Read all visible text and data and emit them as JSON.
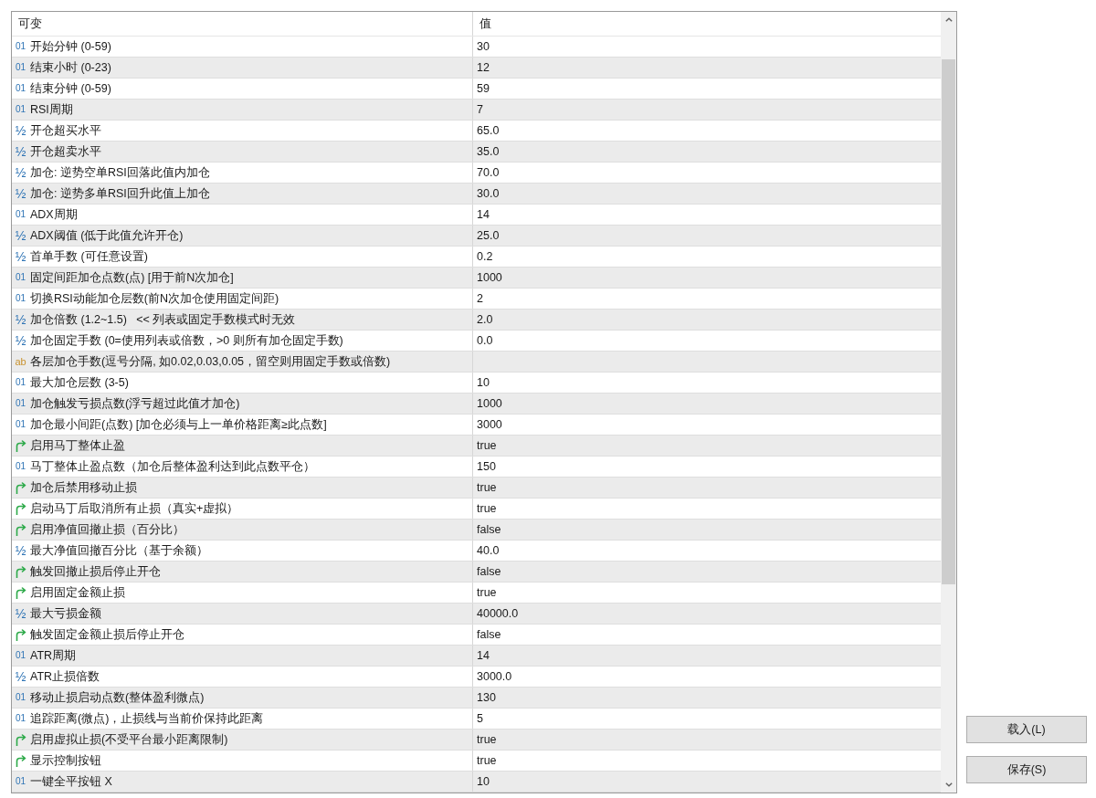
{
  "table": {
    "columns": [
      "可变",
      "值"
    ],
    "rows": [
      {
        "kind": "int",
        "type_icon": "01",
        "name": "开始分钟 (0-59)",
        "value": "30"
      },
      {
        "kind": "int",
        "type_icon": "01",
        "name": "结束小时 (0-23)",
        "value": "12"
      },
      {
        "kind": "int",
        "type_icon": "01",
        "name": "结束分钟 (0-59)",
        "value": "59"
      },
      {
        "kind": "int",
        "type_icon": "01",
        "name": "RSI周期",
        "value": "7"
      },
      {
        "kind": "double",
        "type_icon": "½",
        "name": "开仓超买水平",
        "value": "65.0"
      },
      {
        "kind": "double",
        "type_icon": "½",
        "name": "开仓超卖水平",
        "value": "35.0"
      },
      {
        "kind": "double",
        "type_icon": "½",
        "name": "加仓: 逆势空单RSI回落此值内加仓",
        "value": "70.0"
      },
      {
        "kind": "double",
        "type_icon": "½",
        "name": "加仓: 逆势多单RSI回升此值上加仓",
        "value": "30.0"
      },
      {
        "kind": "int",
        "type_icon": "01",
        "name": "ADX周期",
        "value": "14"
      },
      {
        "kind": "double",
        "type_icon": "½",
        "name": "ADX阈值 (低于此值允许开仓)",
        "value": "25.0"
      },
      {
        "kind": "double",
        "type_icon": "½",
        "name": "首单手数 (可任意设置)",
        "value": "0.2"
      },
      {
        "kind": "int",
        "type_icon": "01",
        "name": "固定间距加仓点数(点) [用于前N次加仓]",
        "value": "1000"
      },
      {
        "kind": "int",
        "type_icon": "01",
        "name": "切换RSI动能加仓层数(前N次加仓使用固定间距)",
        "value": "2"
      },
      {
        "kind": "double",
        "type_icon": "½",
        "name": "加仓倍数 (1.2~1.5)   << 列表或固定手数模式时无效",
        "value": "2.0"
      },
      {
        "kind": "double",
        "type_icon": "½",
        "name": "加仓固定手数 (0=使用列表或倍数，>0 则所有加仓固定手数)",
        "value": "0.0"
      },
      {
        "kind": "string",
        "type_icon": "ab",
        "name": "各层加仓手数(逗号分隔, 如0.02,0.03,0.05，留空则用固定手数或倍数)"
      },
      {
        "kind": "int",
        "type_icon": "01",
        "name": "最大加仓层数 (3-5)",
        "value": "10"
      },
      {
        "kind": "int",
        "type_icon": "01",
        "name": "加仓触发亏损点数(浮亏超过此值才加仓)",
        "value": "1000"
      },
      {
        "kind": "int",
        "type_icon": "01",
        "name": "加仓最小间距(点数) [加仓必须与上一单价格距离≥此点数]",
        "value": "3000"
      },
      {
        "kind": "bool",
        "name": "启用马丁整体止盈",
        "value": "true"
      },
      {
        "kind": "int",
        "type_icon": "01",
        "name": "马丁整体止盈点数（加仓后整体盈利达到此点数平仓）",
        "value": "150"
      },
      {
        "kind": "bool",
        "name": "加仓后禁用移动止损",
        "value": "true"
      },
      {
        "kind": "bool",
        "name": "启动马丁后取消所有止损（真实+虚拟）",
        "value": "true"
      },
      {
        "kind": "bool",
        "name": "启用净值回撤止损（百分比）",
        "value": "false"
      },
      {
        "kind": "double",
        "type_icon": "½",
        "name": "最大净值回撤百分比（基于余额）",
        "value": "40.0"
      },
      {
        "kind": "bool",
        "name": "触发回撤止损后停止开仓",
        "value": "false"
      },
      {
        "kind": "bool",
        "name": "启用固定金额止损",
        "value": "true"
      },
      {
        "kind": "double",
        "type_icon": "½",
        "name": "最大亏损金额",
        "value": "40000.0"
      },
      {
        "kind": "bool",
        "name": "触发固定金额止损后停止开仓",
        "value": "false"
      },
      {
        "kind": "int",
        "type_icon": "01",
        "name": "ATR周期",
        "value": "14"
      },
      {
        "kind": "double",
        "type_icon": "½",
        "name": "ATR止损倍数",
        "value": "3000.0"
      },
      {
        "kind": "int",
        "type_icon": "01",
        "name": "移动止损启动点数(整体盈利微点)",
        "value": "130"
      },
      {
        "kind": "int",
        "type_icon": "01",
        "name": "追踪距离(微点)，止损线与当前价保持此距离",
        "value": "5"
      },
      {
        "kind": "bool",
        "name": "启用虚拟止损(不受平台最小距离限制)",
        "value": "true"
      },
      {
        "kind": "bool",
        "name": "显示控制按钮",
        "value": "true"
      },
      {
        "kind": "int",
        "type_icon": "01",
        "name": "一键全平按钮 X",
        "value": "10"
      }
    ]
  },
  "buttons": [
    {
      "label": "载入(L)"
    },
    {
      "label": "保存(S)"
    }
  ]
}
